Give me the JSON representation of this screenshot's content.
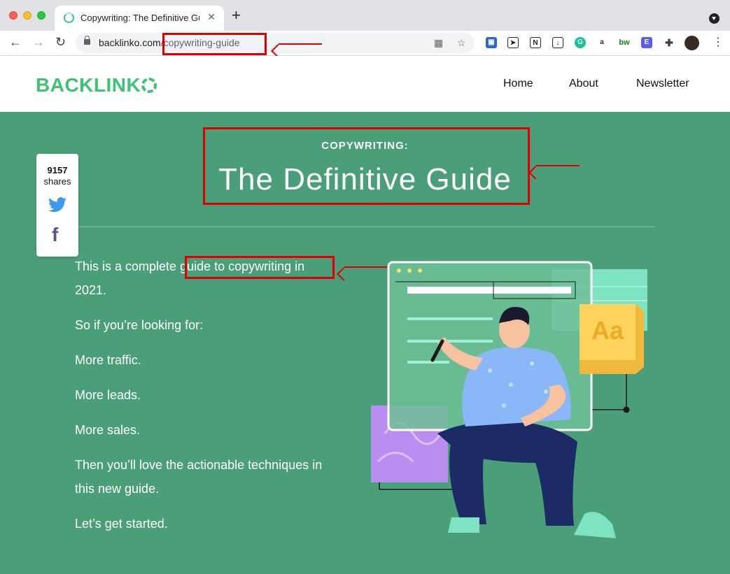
{
  "browser": {
    "tab_title": "Copywriting: The Definitive Gui",
    "new_tab_label": "+",
    "url_domain": "backlinko.com",
    "url_path": "/copywriting-guide"
  },
  "site": {
    "logo": "BACKLINK",
    "nav": [
      "Home",
      "About",
      "Newsletter"
    ]
  },
  "hero": {
    "kicker": "COPYWRITING:",
    "title": "The Definitive Guide"
  },
  "share": {
    "count": "9157",
    "label": "shares"
  },
  "body": {
    "intro_pre": "This is a complete ",
    "intro_highlight": "guide to copywriting in",
    "intro_post": "2021.",
    "p2": "So if you’re looking for:",
    "p3": "More traffic.",
    "p4": "More leads.",
    "p5": "More sales.",
    "p6a": "Then you’ll love the actionable techniques in",
    "p6b": "this new guide.",
    "p7": "Let’s get started."
  },
  "illustration": {
    "badge_text": "Aa"
  },
  "colors": {
    "page_bg": "#4a9e78",
    "brand_green": "#3cc476",
    "annotation_red": "#e00000"
  }
}
